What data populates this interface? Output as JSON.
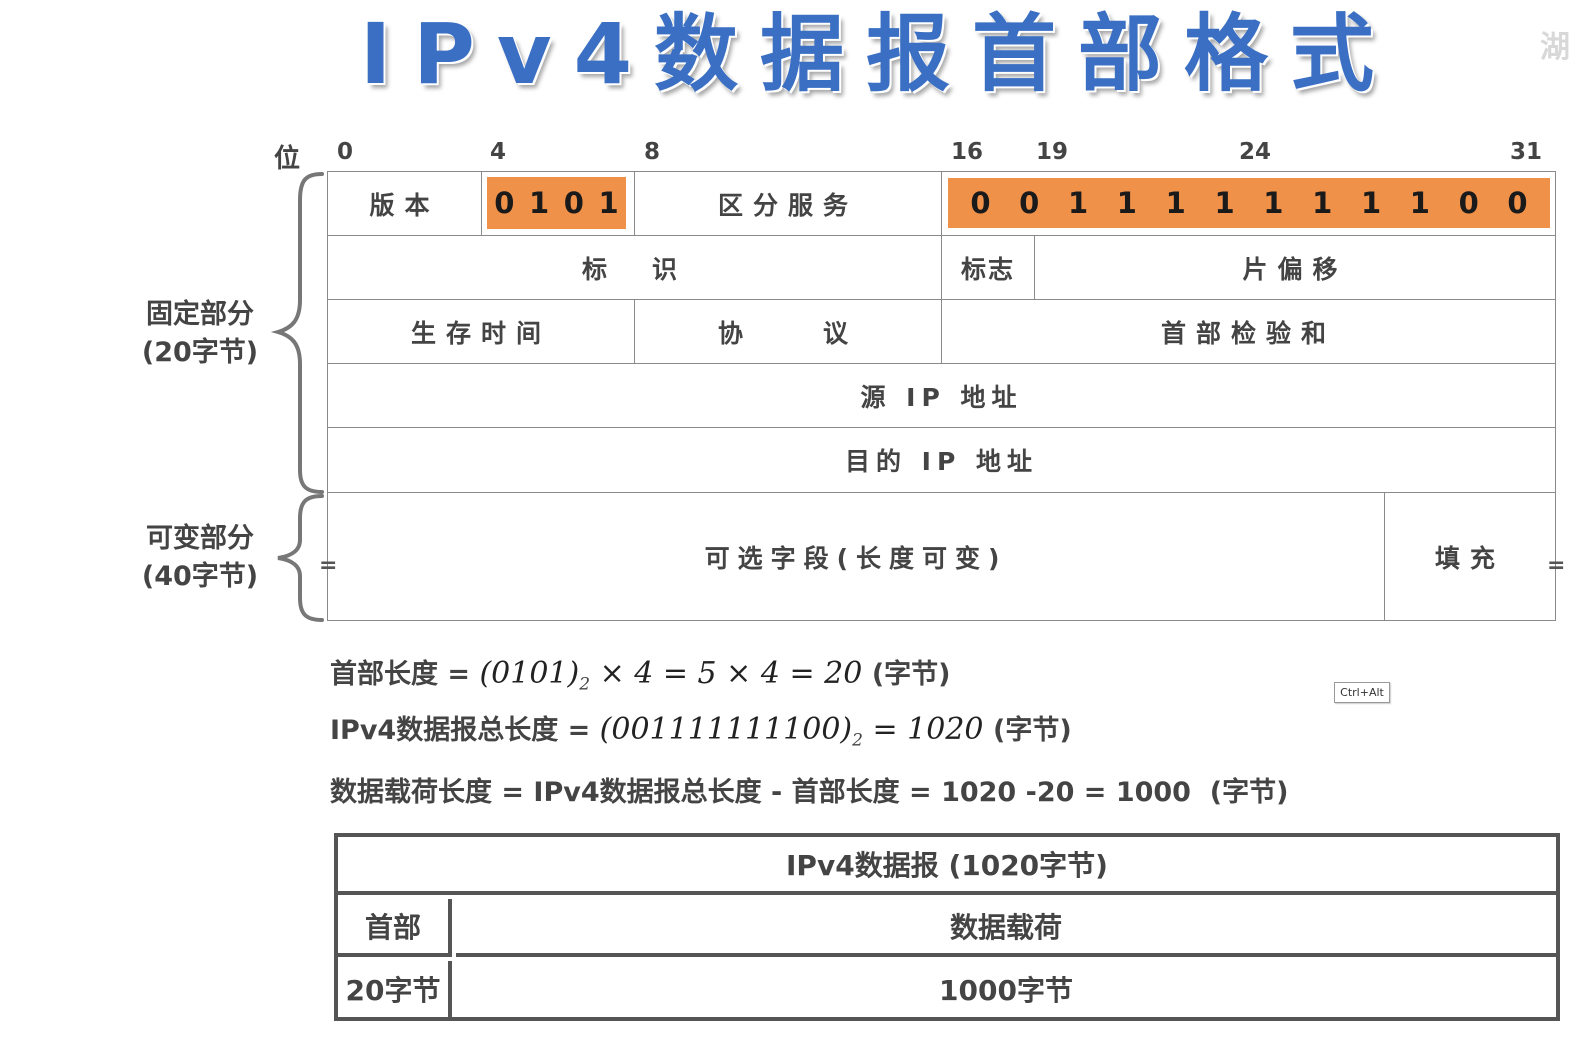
{
  "title": "IPv4数据报首部格式",
  "watermark": "湖",
  "bit_axis": {
    "label": "位",
    "ticks": [
      "0",
      "4",
      "8",
      "16",
      "19",
      "24",
      "31"
    ]
  },
  "side_labels": {
    "fixed": [
      "固定部分",
      "(20字节)"
    ],
    "variable": [
      "可变部分",
      "(40字节)"
    ]
  },
  "header_fields": {
    "version": "版本",
    "version_bits": [
      "0",
      "1",
      "0",
      "1"
    ],
    "dscp": "区分服务",
    "total_length_bits": [
      "0",
      "0",
      "1",
      "1",
      "1",
      "1",
      "1",
      "1",
      "1",
      "1",
      "0",
      "0"
    ],
    "identification": "标　识",
    "flags": "标志",
    "fragment_offset": "片偏移",
    "ttl": "生存时间",
    "protocol": "协　　议",
    "checksum": "首部检验和",
    "src_ip": "源 IP 地址",
    "dst_ip": "目的 IP 地址",
    "options": "可选字段(长度可变)",
    "padding": "填充",
    "eq_mark": "="
  },
  "formulas": {
    "f1_label": "首部长度 = ",
    "f1_math1": "(0101)",
    "f1_sub": "2",
    "f1_math2": " × 4 = 5 × 4 = 20 ",
    "f1_unit": "(字节)",
    "f2_label": "IPv4数据报总长度 = ",
    "f2_math1": "(001111111100)",
    "f2_sub": "2",
    "f2_math2": " = 1020 ",
    "f2_unit": "(字节)",
    "f3": "数据载荷长度 = IPv4数据报总长度 - 首部长度 = 1020 -20 = 1000  (字节)"
  },
  "tooltip": "Ctrl+Alt",
  "bottom_table": {
    "title": "IPv4数据报 (1020字节)",
    "header_label": "首部",
    "payload_label": "数据载荷",
    "header_size": "20字节",
    "payload_size": "1000字节"
  },
  "colors": {
    "title": "#3a6fc4",
    "highlight": "#f0914a",
    "border": "#8a8a8a"
  }
}
